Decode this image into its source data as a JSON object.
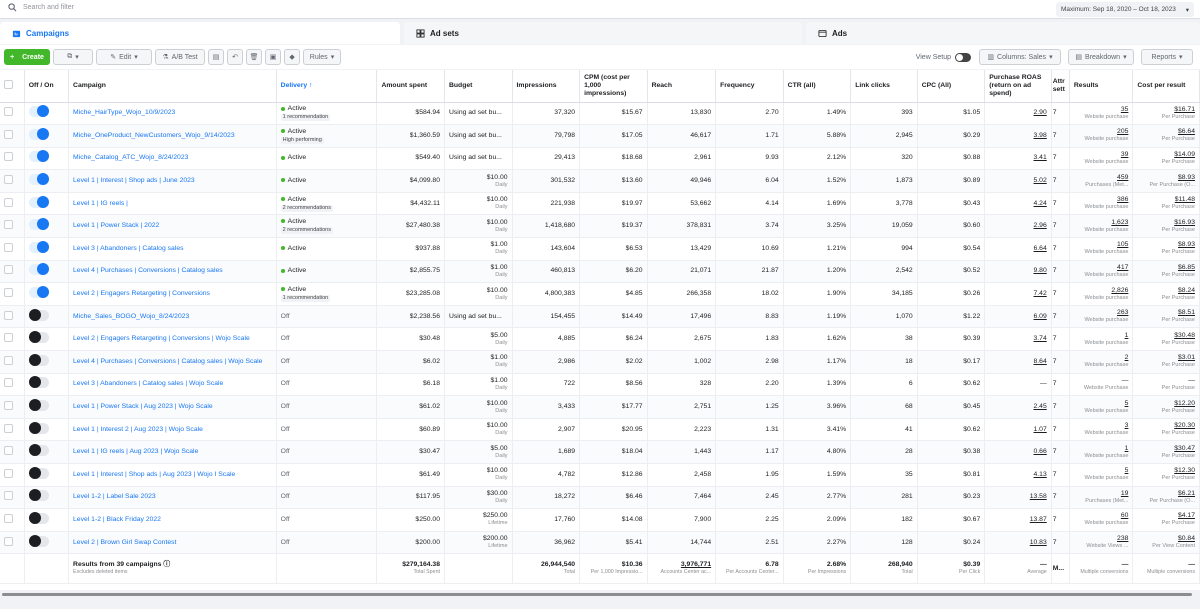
{
  "topbar": {
    "search_placeholder": "Search and filter",
    "date_range": "Maximum: Sep 18, 2020 – Oct 18, 2023"
  },
  "tabs": [
    {
      "label": "Campaigns"
    },
    {
      "label": "Ad sets"
    },
    {
      "label": "Ads"
    }
  ],
  "toolbar": {
    "create": "Create",
    "edit": "Edit",
    "ab_test": "A/B Test",
    "rules": "Rules",
    "view_setup": "View Setup",
    "columns": "Columns: Sales",
    "breakdown": "Breakdown",
    "reports": "Reports"
  },
  "columns": {
    "off_on": "Off / On",
    "campaign": "Campaign",
    "delivery": "Delivery ↑",
    "amount_spent": "Amount spent",
    "budget": "Budget",
    "impressions": "Impressions",
    "cpm": "CPM (cost per 1,000 impressions)",
    "reach": "Reach",
    "frequency": "Frequency",
    "ctr": "CTR (all)",
    "link_clicks": "Link clicks",
    "cpc": "CPC (All)",
    "roas": "Purchase ROAS (return on ad spend)",
    "attr": "Attr sett",
    "results": "Results",
    "cost_per_result": "Cost per result"
  },
  "rows": [
    {
      "on": true,
      "name": "Miche_HairType_Wojo_10/9/2023",
      "delivery": "Active",
      "rec": "1 recommendation",
      "spent": "$584.94",
      "budget": "Using ad set bu...",
      "budget_sub": "",
      "impr": "37,320",
      "cpm": "$15.67",
      "reach": "13,830",
      "freq": "2.70",
      "ctr": "1.49%",
      "clicks": "393",
      "cpc": "$1.05",
      "roas": "2.90",
      "attr": "7",
      "results": "35",
      "results_sub": "Website purchase",
      "cpr": "$16.71",
      "cpr_sub": "Per Purchase"
    },
    {
      "on": true,
      "name": "Miche_OneProduct_NewCustomers_Wojo_9/14/2023",
      "delivery": "Active",
      "rec": "High performing",
      "spent": "$1,360.59",
      "budget": "Using ad set bu...",
      "budget_sub": "",
      "impr": "79,798",
      "cpm": "$17.05",
      "reach": "46,617",
      "freq": "1.71",
      "ctr": "5.88%",
      "clicks": "2,945",
      "cpc": "$0.29",
      "roas": "3.98",
      "attr": "7",
      "results": "205",
      "results_sub": "Website purchase",
      "cpr": "$6.64",
      "cpr_sub": "Per Purchase"
    },
    {
      "on": true,
      "name": "Miche_Catalog_ATC_Wojo_8/24/2023",
      "delivery": "Active",
      "rec": "",
      "spent": "$549.40",
      "budget": "Using ad set bu...",
      "budget_sub": "",
      "impr": "29,413",
      "cpm": "$18.68",
      "reach": "2,961",
      "freq": "9.93",
      "ctr": "2.12%",
      "clicks": "320",
      "cpc": "$0.88",
      "roas": "3.41",
      "attr": "7",
      "results": "39",
      "results_sub": "Website purchase",
      "cpr": "$14.09",
      "cpr_sub": "Per Purchase"
    },
    {
      "on": true,
      "name": "Level 1 | Interest | Shop ads | June 2023",
      "delivery": "Active",
      "rec": "",
      "spent": "$4,099.80",
      "budget": "$10.00",
      "budget_sub": "Daily",
      "impr": "301,532",
      "cpm": "$13.60",
      "reach": "49,946",
      "freq": "6.04",
      "ctr": "1.52%",
      "clicks": "1,873",
      "cpc": "$0.89",
      "roas": "5.02",
      "attr": "7",
      "results": "459",
      "results_sub": "Purchases (Met...",
      "cpr": "$8.93",
      "cpr_sub": "Per Purchase (O..."
    },
    {
      "on": true,
      "name": "Level 1 | IG reels |",
      "delivery": "Active",
      "rec": "2 recommendations",
      "spent": "$4,432.11",
      "budget": "$10.00",
      "budget_sub": "Daily",
      "impr": "221,938",
      "cpm": "$19.97",
      "reach": "53,662",
      "freq": "4.14",
      "ctr": "1.69%",
      "clicks": "3,778",
      "cpc": "$0.43",
      "roas": "4.24",
      "attr": "7",
      "results": "386",
      "results_sub": "Website purchase",
      "cpr": "$11.48",
      "cpr_sub": "Per Purchase"
    },
    {
      "on": true,
      "name": "Level 1 | Power Stack | 2022",
      "delivery": "Active",
      "rec": "2 recommendations",
      "spent": "$27,480.38",
      "budget": "$10.00",
      "budget_sub": "Daily",
      "impr": "1,418,680",
      "cpm": "$19.37",
      "reach": "378,831",
      "freq": "3.74",
      "ctr": "3.25%",
      "clicks": "19,059",
      "cpc": "$0.60",
      "roas": "2.96",
      "attr": "7",
      "results": "1,623",
      "results_sub": "Website purchase",
      "cpr": "$16.93",
      "cpr_sub": "Per Purchase"
    },
    {
      "on": true,
      "name": "Level 3 | Abandoners | Catalog sales",
      "delivery": "Active",
      "rec": "",
      "spent": "$937.88",
      "budget": "$1.00",
      "budget_sub": "Daily",
      "impr": "143,604",
      "cpm": "$6.53",
      "reach": "13,429",
      "freq": "10.69",
      "ctr": "1.21%",
      "clicks": "994",
      "cpc": "$0.54",
      "roas": "6.64",
      "attr": "7",
      "results": "105",
      "results_sub": "Website purchase",
      "cpr": "$8.93",
      "cpr_sub": "Per Purchase"
    },
    {
      "on": true,
      "name": "Level 4 | Purchases | Conversions | Catalog sales",
      "delivery": "Active",
      "rec": "",
      "spent": "$2,855.75",
      "budget": "$1.00",
      "budget_sub": "Daily",
      "impr": "460,813",
      "cpm": "$6.20",
      "reach": "21,071",
      "freq": "21.87",
      "ctr": "1.20%",
      "clicks": "2,542",
      "cpc": "$0.52",
      "roas": "9.80",
      "attr": "7",
      "results": "417",
      "results_sub": "Website purchase",
      "cpr": "$6.85",
      "cpr_sub": "Per Purchase"
    },
    {
      "on": true,
      "name": "Level 2 | Engagers Retargeting | Conversions",
      "delivery": "Active",
      "rec": "1 recommendation",
      "spent": "$23,285.08",
      "budget": "$10.00",
      "budget_sub": "Daily",
      "impr": "4,800,383",
      "cpm": "$4.85",
      "reach": "266,358",
      "freq": "18.02",
      "ctr": "1.90%",
      "clicks": "34,185",
      "cpc": "$0.26",
      "roas": "7.42",
      "attr": "7",
      "results": "2,826",
      "results_sub": "Website purchase",
      "cpr": "$8.24",
      "cpr_sub": "Per Purchase"
    },
    {
      "on": false,
      "name": "Miche_Sales_BOGO_Wojo_8/24/2023",
      "delivery": "Off",
      "rec": "",
      "spent": "$2,238.56",
      "budget": "Using ad set bu...",
      "budget_sub": "",
      "impr": "154,455",
      "cpm": "$14.49",
      "reach": "17,496",
      "freq": "8.83",
      "ctr": "1.19%",
      "clicks": "1,070",
      "cpc": "$1.22",
      "roas": "6.09",
      "attr": "7",
      "results": "263",
      "results_sub": "Website purchase",
      "cpr": "$8.51",
      "cpr_sub": "Per Purchase"
    },
    {
      "on": false,
      "name": "Level 2 | Engagers Retargeting | Conversions | Wojo Scale",
      "delivery": "Off",
      "rec": "",
      "spent": "$30.48",
      "budget": "$5.00",
      "budget_sub": "Daily",
      "impr": "4,885",
      "cpm": "$6.24",
      "reach": "2,675",
      "freq": "1.83",
      "ctr": "1.62%",
      "clicks": "38",
      "cpc": "$0.39",
      "roas": "3.74",
      "attr": "7",
      "results": "1",
      "results_sub": "Website purchase",
      "cpr": "$30.48",
      "cpr_sub": "Per Purchase"
    },
    {
      "on": false,
      "name": "Level 4 | Purchases | Conversions | Catalog sales | Wojo Scale",
      "delivery": "Off",
      "rec": "",
      "spent": "$6.02",
      "budget": "$1.00",
      "budget_sub": "Daily",
      "impr": "2,986",
      "cpm": "$2.02",
      "reach": "1,002",
      "freq": "2.98",
      "ctr": "1.17%",
      "clicks": "18",
      "cpc": "$0.17",
      "roas": "8.64",
      "attr": "7",
      "results": "2",
      "results_sub": "Website purchase",
      "cpr": "$3.01",
      "cpr_sub": "Per Purchase"
    },
    {
      "on": false,
      "name": "Level 3 | Abandoners | Catalog sales | Wojo Scale",
      "delivery": "Off",
      "rec": "",
      "spent": "$6.18",
      "budget": "$1.00",
      "budget_sub": "Daily",
      "impr": "722",
      "cpm": "$8.56",
      "reach": "328",
      "freq": "2.20",
      "ctr": "1.39%",
      "clicks": "6",
      "cpc": "$0.62",
      "roas": "—",
      "attr": "7",
      "results": "—",
      "results_sub": "Website Purchase",
      "cpr": "—",
      "cpr_sub": "Per Purchase"
    },
    {
      "on": false,
      "name": "Level 1 | Power Stack | Aug 2023 | Wojo Scale",
      "delivery": "Off",
      "rec": "",
      "spent": "$61.02",
      "budget": "$10.00",
      "budget_sub": "Daily",
      "impr": "3,433",
      "cpm": "$17.77",
      "reach": "2,751",
      "freq": "1.25",
      "ctr": "3.96%",
      "clicks": "68",
      "cpc": "$0.45",
      "roas": "2.45",
      "attr": "7",
      "results": "5",
      "results_sub": "Website purchase",
      "cpr": "$12.20",
      "cpr_sub": "Per Purchase"
    },
    {
      "on": false,
      "name": "Level 1 | Interest 2 | Aug 2023 | Wojo Scale",
      "delivery": "Off",
      "rec": "",
      "spent": "$60.89",
      "budget": "$10.00",
      "budget_sub": "Daily",
      "impr": "2,907",
      "cpm": "$20.95",
      "reach": "2,223",
      "freq": "1.31",
      "ctr": "3.41%",
      "clicks": "41",
      "cpc": "$0.62",
      "roas": "1.07",
      "attr": "7",
      "results": "3",
      "results_sub": "Website purchase",
      "cpr": "$20.30",
      "cpr_sub": "Per Purchase"
    },
    {
      "on": false,
      "name": "Level 1 | IG reels | Aug 2023 | Wojo Scale",
      "delivery": "Off",
      "rec": "",
      "spent": "$30.47",
      "budget": "$5.00",
      "budget_sub": "Daily",
      "impr": "1,689",
      "cpm": "$18.04",
      "reach": "1,443",
      "freq": "1.17",
      "ctr": "4.80%",
      "clicks": "28",
      "cpc": "$0.38",
      "roas": "0.66",
      "attr": "7",
      "results": "1",
      "results_sub": "Website purchase",
      "cpr": "$30.47",
      "cpr_sub": "Per Purchase"
    },
    {
      "on": false,
      "name": "Level 1 | Interest | Shop ads | Aug 2023 | Wojo I Scale",
      "delivery": "Off",
      "rec": "",
      "spent": "$61.49",
      "budget": "$10.00",
      "budget_sub": "Daily",
      "impr": "4,782",
      "cpm": "$12.86",
      "reach": "2,458",
      "freq": "1.95",
      "ctr": "1.59%",
      "clicks": "35",
      "cpc": "$0.81",
      "roas": "4.13",
      "attr": "7",
      "results": "5",
      "results_sub": "Website purchase",
      "cpr": "$12.30",
      "cpr_sub": "Per Purchase"
    },
    {
      "on": false,
      "name": "Level 1-2 | Label Sale 2023",
      "delivery": "Off",
      "rec": "",
      "spent": "$117.95",
      "budget": "$30.00",
      "budget_sub": "Daily",
      "impr": "18,272",
      "cpm": "$6.46",
      "reach": "7,464",
      "freq": "2.45",
      "ctr": "2.77%",
      "clicks": "281",
      "cpc": "$0.23",
      "roas": "13.58",
      "attr": "7",
      "results": "19",
      "results_sub": "Purchases (Met...",
      "cpr": "$6.21",
      "cpr_sub": "Per Purchase (O..."
    },
    {
      "on": false,
      "name": "Level 1-2 | Black Friday 2022",
      "delivery": "Off",
      "rec": "",
      "spent": "$250.00",
      "budget": "$250.00",
      "budget_sub": "Lifetime",
      "impr": "17,760",
      "cpm": "$14.08",
      "reach": "7,900",
      "freq": "2.25",
      "ctr": "2.09%",
      "clicks": "182",
      "cpc": "$0.67",
      "roas": "13.87",
      "attr": "7",
      "results": "60",
      "results_sub": "Website purchase",
      "cpr": "$4.17",
      "cpr_sub": "Per Purchase"
    },
    {
      "on": false,
      "name": "Level 2 | Brown Girl Swap Contest",
      "delivery": "Off",
      "rec": "",
      "spent": "$200.00",
      "budget": "$200.00",
      "budget_sub": "Lifetime",
      "impr": "36,962",
      "cpm": "$5.41",
      "reach": "14,744",
      "freq": "2.51",
      "ctr": "2.27%",
      "clicks": "128",
      "cpc": "$0.24",
      "roas": "10.83",
      "attr": "7",
      "results": "238",
      "results_sub": "Website Views ...",
      "cpr": "$0.84",
      "cpr_sub": "Per View Content"
    }
  ],
  "footer": {
    "label": "Results from 39 campaigns",
    "label_sub": "Excludes deleted items",
    "spent": "$279,164.38",
    "spent_sub": "Total Spent",
    "impr": "26,944,540",
    "impr_sub": "Total",
    "cpm": "$10.36",
    "cpm_sub": "Per 1,000 Impressio...",
    "reach": "3,976,771",
    "reach_sub": "Accounts Center ac...",
    "freq": "6.78",
    "freq_sub": "Per Accounts Center...",
    "ctr": "2.68%",
    "ctr_sub": "Per Impressions",
    "clicks": "268,940",
    "clicks_sub": "Total",
    "cpc": "$0.39",
    "cpc_sub": "Per Click",
    "roas": "—",
    "roas_sub": "Average",
    "attr": "M...",
    "results": "—",
    "results_sub": "Multiple conversions",
    "cpr": "—",
    "cpr_sub": "Multiple conversions"
  }
}
